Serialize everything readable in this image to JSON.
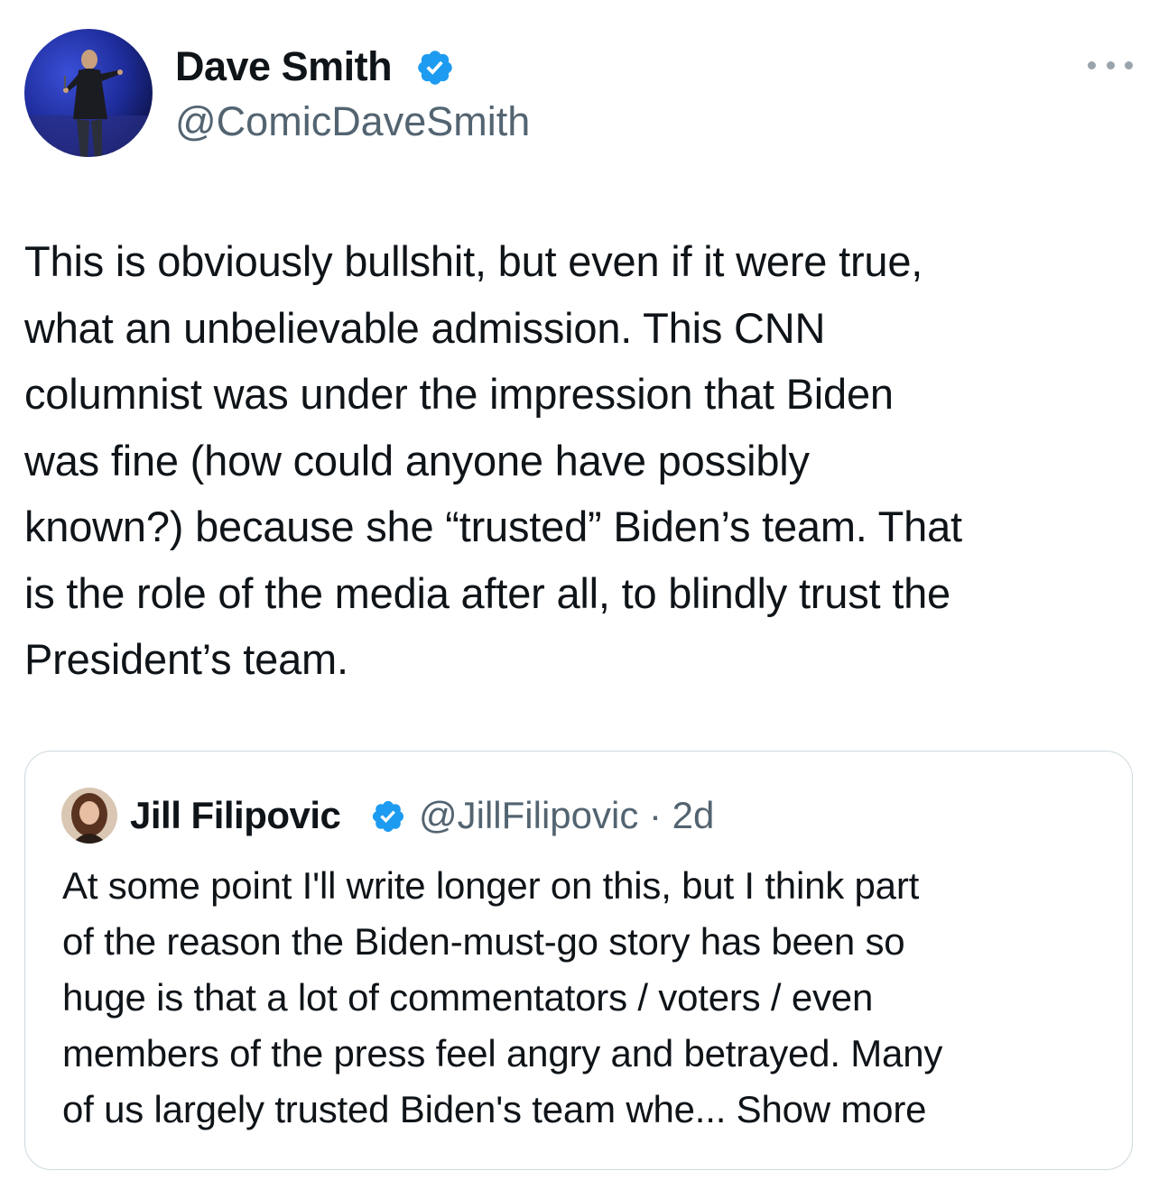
{
  "tweet": {
    "author": {
      "name": "Dave Smith",
      "handle": "@ComicDaveSmith",
      "verified": true
    },
    "text": "This is obviously bullshit, but even if it were true,\nwhat an unbelievable admission. This CNN\ncolumnist was under the impression that Biden\nwas fine (how could anyone have possibly\nknown?) because she “trusted” Biden’s team. That\nis the role of the media after all, to blindly trust the\nPresident’s team.",
    "more_icon": "more-horizontal-icon"
  },
  "quote": {
    "author": {
      "name": "Jill Filipovic",
      "handle": "@JillFilipovic",
      "verified": true
    },
    "separator": "·",
    "time": "2d",
    "text": "At some point I'll write longer on this, but I think part\nof the reason the Biden-must-go story has been so\nhuge is that a lot of commentators / voters / even\nmembers of the press feel angry and betrayed. Many\nof us largely trusted Biden's team whe... Show more"
  },
  "colors": {
    "text_primary": "#0f1419",
    "text_secondary": "#536471",
    "verified_blue": "#1d9bf0",
    "border": "#cfd9de"
  }
}
